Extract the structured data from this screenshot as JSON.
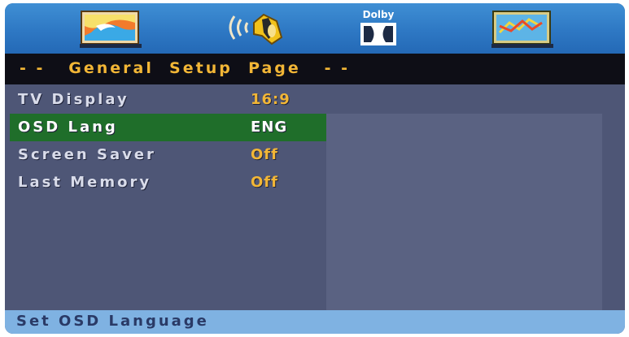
{
  "icons": {
    "general": "general-setup-icon",
    "audio": "audio-speaker-icon",
    "dolby": "dolby-icon",
    "preference": "preference-icon"
  },
  "dolby_text": "Dolby",
  "header": {
    "title": "- -   General  Setup  Page   - -"
  },
  "menu": [
    {
      "label": "TV  Display",
      "value": "16:9"
    },
    {
      "label": "OSD  Lang",
      "value": "ENG"
    },
    {
      "label": "Screen  Saver",
      "value": "Off"
    },
    {
      "label": "Last  Memory",
      "value": "Off"
    }
  ],
  "selected_index": 1,
  "status": {
    "text": "Set  OSD  Language"
  },
  "colors": {
    "icon_bar": "#2e78c4",
    "header_bg": "#0e0e16",
    "title_text": "#f2b636",
    "selection": "#1f6e2a",
    "status_bar": "#7fb2e2"
  }
}
